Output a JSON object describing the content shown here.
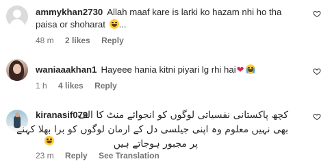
{
  "comments": [
    {
      "username": "ammykhan2730",
      "text_line1": "Allah maaf kare is larki ko hazam nhi ho tha",
      "text_line2": "paisa or shoharat",
      "text_line2_suffix": "...",
      "time": "48 m",
      "likes": "2 likes",
      "reply": "Reply"
    },
    {
      "username": "waniaaakhan1",
      "text_line1": "Hayeee hania kitni piyari lg rhi hai",
      "heart": "❤",
      "time": "1 h",
      "likes": "4 likes",
      "reply": "Reply"
    },
    {
      "username": "kiranasif079",
      "urdu_lines": [
        "کچھ پاکستانی نفسیاتی لوگوں کو انجوائے منٹ کا الف",
        "بھی نہیں معلوم وہ اپنی جیلسی دل کے ارمان لوگوں کو برا بھلا کہنے",
        "پر مجبور ہوجاتے ہیں"
      ],
      "time": "23 m",
      "reply": "Reply",
      "see_translation": "See Translation"
    }
  ],
  "icons": {
    "like": "heart-outline-icon",
    "avatar": "avatar"
  },
  "colors": {
    "text": "#262626",
    "meta": "#737373",
    "heart_red": "#e0245e"
  }
}
